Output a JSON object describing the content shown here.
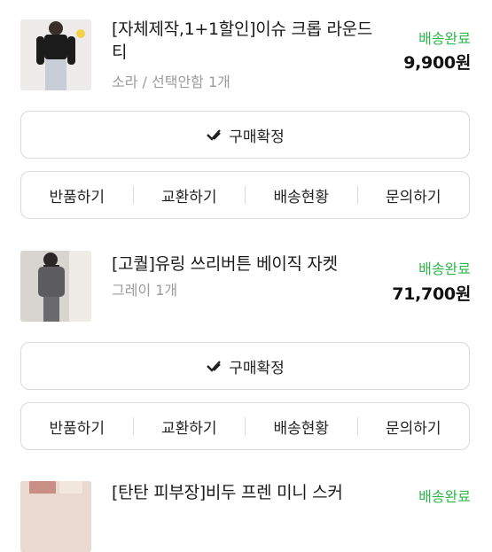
{
  "orders": [
    {
      "title": "[자체제작,1+1할인]이슈 크롭 라운드티",
      "option": "소라 / 선택안함 1개",
      "status": "배송완료",
      "price": "9,900원",
      "thumb_icon": "product-photo-black-top"
    },
    {
      "title": "[고퀄]유링 쓰리버튼 베이직 자켓",
      "option": "그레이 1개",
      "status": "배송완료",
      "price": "71,700원",
      "thumb_icon": "product-photo-gray-jacket"
    },
    {
      "title": "[탄탄 피부장]비두 프렌 미니 스커",
      "option": "",
      "status": "배송완료",
      "price": "",
      "thumb_icon": "product-photo-skirt"
    }
  ],
  "buttons": {
    "confirm": "구매확정",
    "return": "반품하기",
    "exchange": "교환하기",
    "tracking": "배송현황",
    "inquiry": "문의하기"
  },
  "colors": {
    "status_green": "#2db84b",
    "border": "#d9d9d9"
  }
}
